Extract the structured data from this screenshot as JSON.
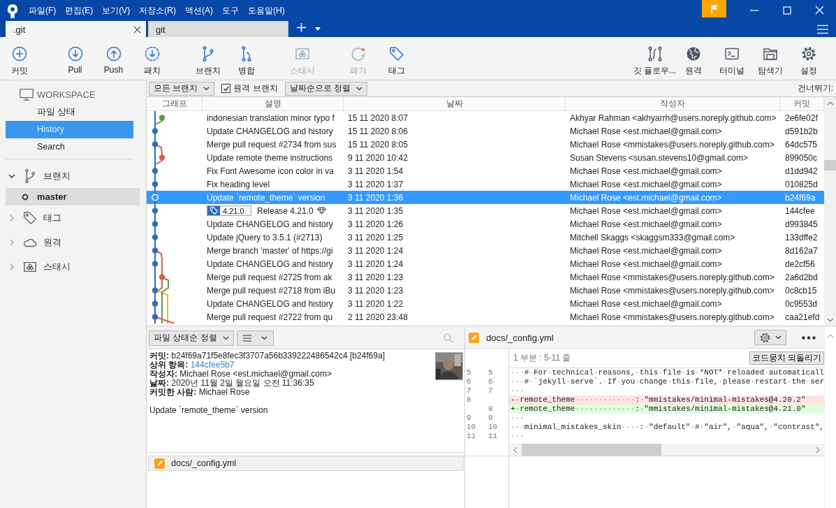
{
  "title_bar": {
    "menu": [
      "파일(F)",
      "편집(E)",
      "보기(V)",
      "저장소(R)",
      "액션(A)",
      "도구",
      "도움말(H)"
    ]
  },
  "tabs": [
    {
      "label": ".git",
      "selected": true
    },
    {
      "label": "git",
      "selected": false
    }
  ],
  "toolbar": {
    "left": [
      {
        "label": "커밋",
        "disabled": false
      },
      {
        "label": "Pull",
        "disabled": false
      },
      {
        "label": "Push",
        "disabled": false
      },
      {
        "label": "패치",
        "disabled": false
      },
      {
        "label": "브랜치",
        "disabled": false
      },
      {
        "label": "병합",
        "disabled": false
      },
      {
        "label": "스태시",
        "disabled": true
      },
      {
        "label": "폐기",
        "disabled": true
      },
      {
        "label": "태그",
        "disabled": false
      }
    ],
    "right": [
      {
        "label": "깃 플로우...",
        "disabled": false
      },
      {
        "label": "원격",
        "disabled": false
      },
      {
        "label": "터미널",
        "disabled": false
      },
      {
        "label": "탐색기",
        "disabled": false
      },
      {
        "label": "설정",
        "disabled": false
      }
    ]
  },
  "sidebar": {
    "workspace": {
      "title": "WORKSPACE",
      "items": [
        {
          "label": "파일 상태",
          "selected": false
        },
        {
          "label": "History",
          "selected": true
        },
        {
          "label": "Search",
          "selected": false
        }
      ]
    },
    "groups": [
      {
        "label": "브랜치",
        "expanded": true,
        "children": [
          {
            "label": "master",
            "current": true,
            "selected": true
          }
        ]
      },
      {
        "label": "태그",
        "expanded": false
      },
      {
        "label": "원격",
        "expanded": false
      },
      {
        "label": "스태시",
        "expanded": false
      }
    ]
  },
  "filter_bar": {
    "branch_filter": "모든 브랜치",
    "remote_branches": {
      "label": "원격 브랜치",
      "checked": true
    },
    "sort": "날짜순으로 정렬",
    "skip_label": "건너뛰기:"
  },
  "table": {
    "columns": [
      "그래프",
      "설명",
      "날짜",
      "작성자",
      "커밋"
    ],
    "rows": [
      {
        "description": "indonesian translation minor typo f",
        "date": "15 11 2020 8:07",
        "author": "Akhyar Rahman <akhyarrh@users.noreply.github.com>",
        "commit": "2e6fe02f",
        "selected": false
      },
      {
        "description": "Update CHANGELOG and history",
        "date": "15 11 2020 8:06",
        "author": "Michael Rose <est.michael@gmail.com>",
        "commit": "d591b2b",
        "selected": false
      },
      {
        "description": "Merge pull request #2734 from sus",
        "date": "15 11 2020 8:05",
        "author": "Michael Rose <mmistakes@users.noreply.github.com>",
        "commit": "64dc575",
        "selected": false
      },
      {
        "description": "Update remote theme instructions",
        "date": "9 11 2020 10:42",
        "author": "Susan Stevens <susan.stevens10@gmail.com>",
        "commit": "899050c",
        "selected": false
      },
      {
        "description": "Fix Font Awesome icon color in va",
        "date": "3 11 2020 1:54",
        "author": "Michael Rose <est.michael@gmail.com>",
        "commit": "d1dd942",
        "selected": false
      },
      {
        "description": "Fix heading level",
        "date": "3 11 2020 1:37",
        "author": "Michael Rose <est.michael@gmail.com>",
        "commit": "010825d",
        "selected": false
      },
      {
        "description": "Update `remote_theme` version",
        "date": "3 11 2020 1:36",
        "author": "Michael Rose <est.michael@gmail.com>",
        "commit": "b24f69a",
        "selected": true
      },
      {
        "description": "Release 4.21.0",
        "tag": "4.21.0",
        "date": "3 11 2020 1:35",
        "author": "Michael Rose <est.michael@gmail.com>",
        "commit": "144cfee",
        "selected": false
      },
      {
        "description": "Update CHANGELOG and history",
        "date": "3 11 2020 1:26",
        "author": "Michael Rose <est.michael@gmail.com>",
        "commit": "d993845",
        "selected": false
      },
      {
        "description": "Update jQuery to 3.5.1 (#2713)",
        "date": "3 11 2020 1:25",
        "author": "Mitchell Skaggs <skaggsm333@gmail.com>",
        "commit": "133dffe2",
        "selected": false
      },
      {
        "description": "Merge branch 'master' of https://gi",
        "date": "3 11 2020 1:24",
        "author": "Michael Rose <est.michael@gmail.com>",
        "commit": "8d162a7",
        "selected": false
      },
      {
        "description": "Update CHANGELOG and history",
        "date": "3 11 2020 1:24",
        "author": "Michael Rose <est.michael@gmail.com>",
        "commit": "de2cf56",
        "selected": false
      },
      {
        "description": "Merge pull request #2725 from ak",
        "date": "3 11 2020 1:23",
        "author": "Michael Rose <mmistakes@users.noreply.github.com>",
        "commit": "2a6d2bd",
        "selected": false
      },
      {
        "description": "Merge pull request #2718 from iBu",
        "date": "3 11 2020 1:23",
        "author": "Michael Rose <mmistakes@users.noreply.github.com>",
        "commit": "0c8cb15",
        "selected": false
      },
      {
        "description": "Update CHANGELOG and history",
        "date": "3 11 2020 1:22",
        "author": "Michael Rose <est.michael@gmail.com>",
        "commit": "0c9553d",
        "selected": false
      },
      {
        "description": "Merge pull request #2722 from qu",
        "date": "2 11 2020 23:48",
        "author": "Michael Rose <mmistakes@users.noreply.github.com>",
        "commit": "caa21efd",
        "selected": false
      }
    ]
  },
  "file_panel": {
    "sort": "파일 상태순 정렬",
    "details": [
      {
        "label": "커밋:",
        "value": "b24f69a71f5e8fec3f3707a56b339222486542c4 [b24f69a]",
        "kind": "text"
      },
      {
        "label": "상위 항목:",
        "value": "144cfee5b7",
        "kind": "link"
      },
      {
        "label": "작성자:",
        "value": "Michael Rose <est.michael@gmail.com>",
        "kind": "text"
      },
      {
        "label": "날짜:",
        "value": "2020년 11월 2일 월요일 오전 11:36:35",
        "kind": "text"
      },
      {
        "label": "커밋한 사람:",
        "value": "Michael Rose",
        "kind": "text"
      }
    ],
    "message": "Update `remote_theme` version",
    "files": [
      {
        "path": "docs/_config.yml",
        "selected": true
      }
    ]
  },
  "diff": {
    "file": "docs/_config.yml",
    "hunk": "1 부분 : 5-11 줄",
    "revert_button": "코드뭉치 되돌리기",
    "lines": [
      {
        "old": "5",
        "new": "5",
        "kind": "context",
        "text": "···#·For·technical·reasons,·this·file·is·*NOT*·reloaded·automaticall"
      },
      {
        "old": "6",
        "new": "6",
        "kind": "context",
        "text": "···#·`jekyll·serve`.·If·you·change·this·file,·please·restart·the·ser"
      },
      {
        "old": "7",
        "new": "7",
        "kind": "context",
        "text": "···"
      },
      {
        "old": "8",
        "kind": "removed",
        "text": "-·remote_theme·············:·\"mmistakes/minimal-mistakes@4.20.2\""
      },
      {
        "new": "8",
        "kind": "added",
        "text": "+·remote_theme·············:·\"mmistakes/minimal-mistakes@4.21.0\""
      },
      {
        "old": "9",
        "new": "9",
        "kind": "context",
        "text": "···"
      },
      {
        "old": "10",
        "new": "10",
        "kind": "context",
        "text": "···minimal_mistakes_skin····:·\"default\"·#·\"air\",·\"aqua\",·\"contrast\","
      },
      {
        "old": "11",
        "new": "11",
        "kind": "context",
        "text": "···"
      }
    ]
  }
}
